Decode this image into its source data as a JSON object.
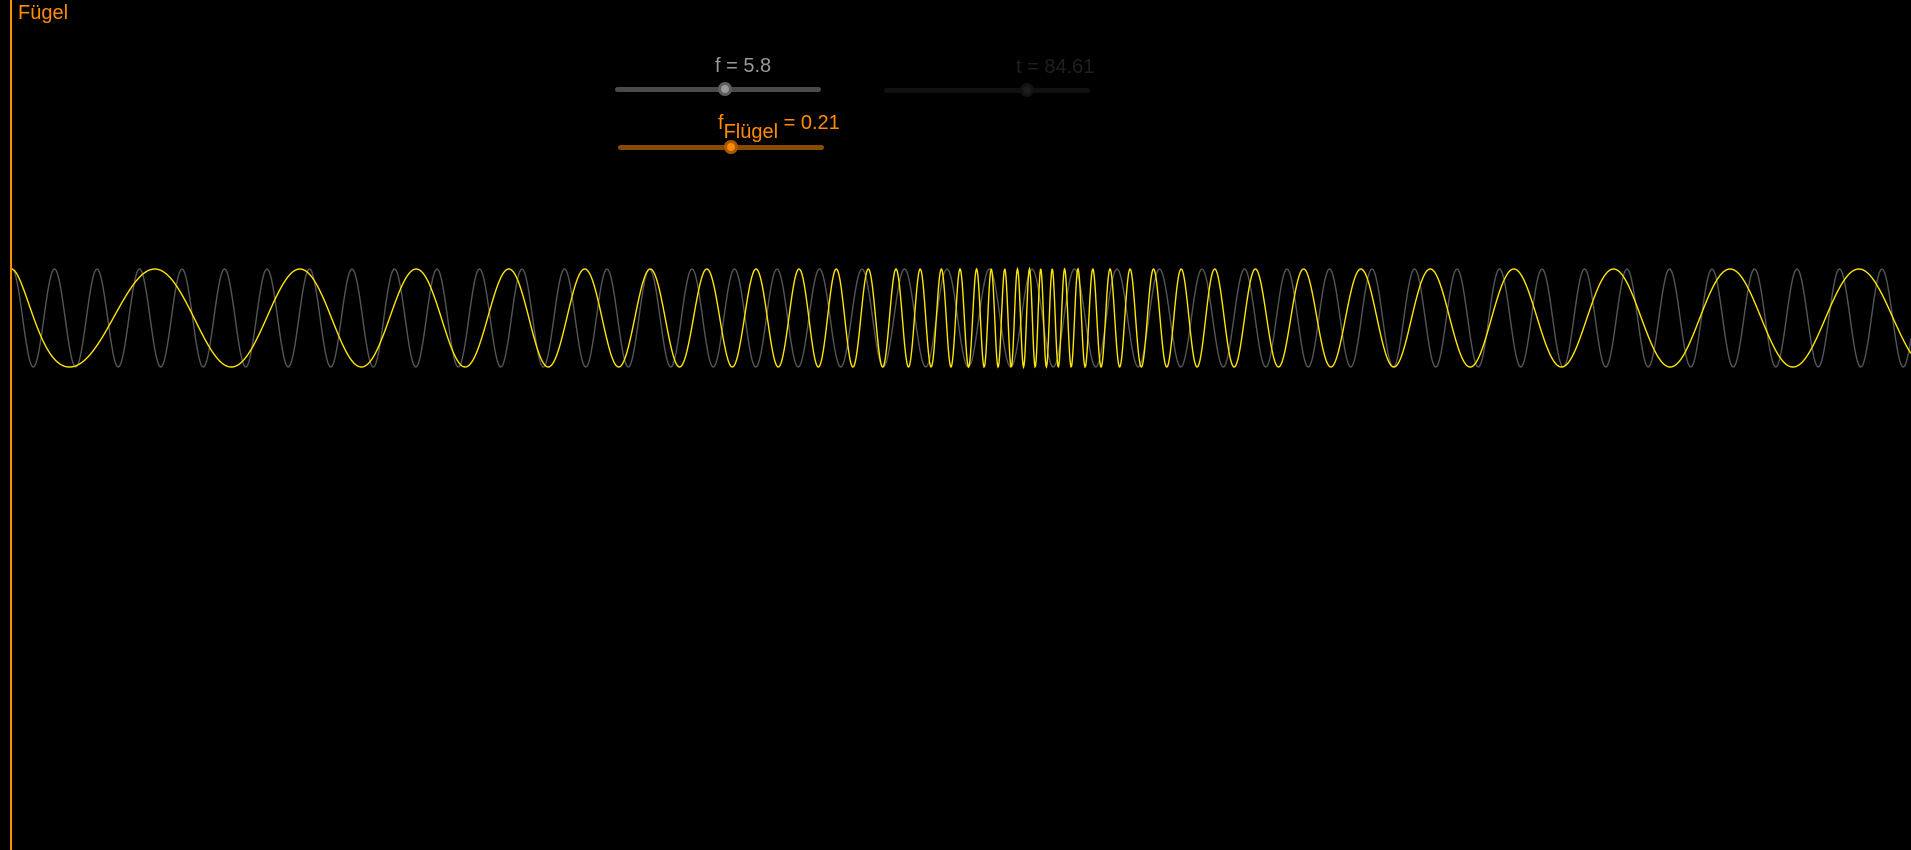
{
  "canvas": {
    "axis_label": "Fügel"
  },
  "sliders": {
    "f": {
      "name": "f",
      "value": "5.8",
      "text": "f = 5.8"
    },
    "t": {
      "name": "t",
      "value": "84.61",
      "text": "t = 84.61"
    },
    "wing": {
      "name_main": "f",
      "name_sub": "Flügel",
      "value_text": " = 0.21",
      "value": "0.21"
    }
  },
  "colors": {
    "background": "#000000",
    "accent_orange": "#ff8c00",
    "wave_yellow": "#ffe600",
    "wave_grey": "#555555"
  },
  "chart_data": {
    "type": "line",
    "series": [
      {
        "name": "",
        "color": "#555555",
        "frequency": 5.8,
        "description_kind": "constant-frequency sine"
      },
      {
        "name": "",
        "color": "#ffe600",
        "frequency": 0.21,
        "description_kind": "chirp sine"
      }
    ],
    "ylim": [
      -1,
      1
    ]
  }
}
